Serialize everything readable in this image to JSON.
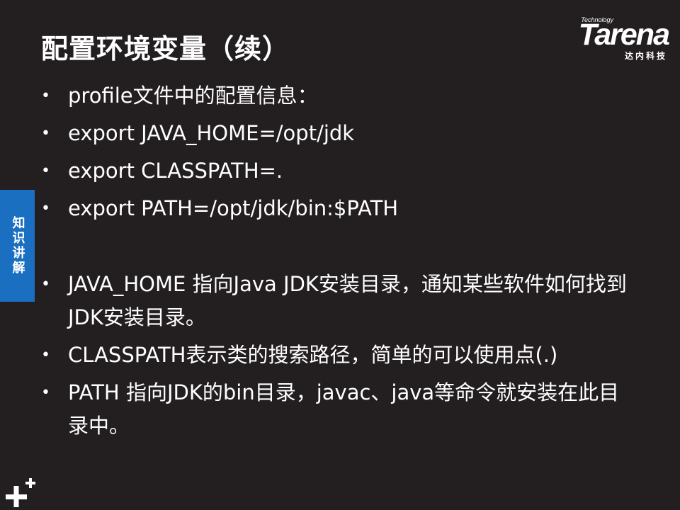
{
  "slide": {
    "title": "配置环境变量（续）",
    "side_tab": "知识讲解"
  },
  "logo": {
    "small_text": "Technology",
    "brand": "Tarena",
    "subtitle": "达内科技"
  },
  "bullets_top": [
    "profile文件中的配置信息：",
    "export JAVA_HOME=/opt/jdk",
    "export CLASSPATH=.",
    "export PATH=/opt/jdk/bin:$PATH"
  ],
  "bullets_bottom": [
    "JAVA_HOME 指向Java JDK安装目录，通知某些软件如何找到JDK安装目录。",
    "CLASSPATH表示类的搜索路径，简单的可以使用点(.)",
    "PATH 指向JDK的bin目录，javac、java等命令就安装在此目录中。"
  ],
  "bullet_glyph": "•",
  "colors": {
    "background": "#231f20",
    "text": "#ffffff",
    "side_tab": "#1a6fc0"
  },
  "icons": {
    "corner": "plus-decoration-icon"
  }
}
